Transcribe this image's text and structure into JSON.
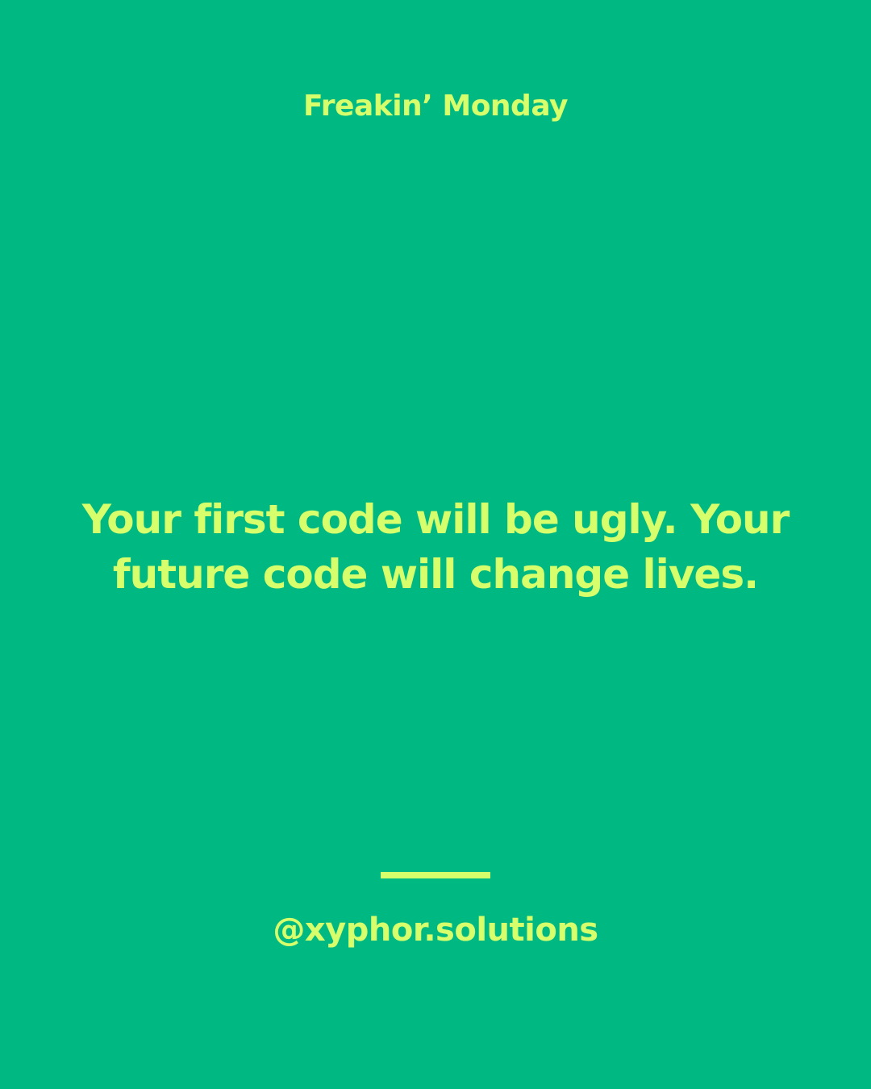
{
  "colors": {
    "background": "#00B982",
    "accent": "#D6FF6B"
  },
  "header": {
    "title": "Freakin’ Monday"
  },
  "quote": {
    "text": "Your first code will be ugly. Your future code will change lives."
  },
  "footer": {
    "handle": "@xyphor.solutions"
  }
}
